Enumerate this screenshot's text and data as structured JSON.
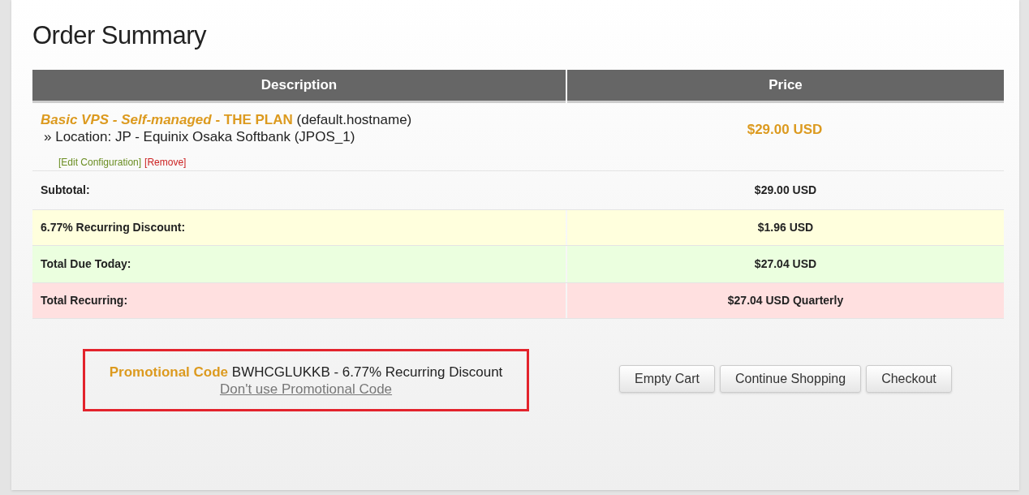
{
  "title": "Order Summary",
  "table": {
    "columns": [
      "Description",
      "Price"
    ],
    "item": {
      "product": "*Basic VPS - Self-managed* - THE PLAN",
      "hostname": "(default.hostname)",
      "location": "» Location: JP - Equinix Osaka Softbank (JPOS_1)",
      "links": [
        {
          "label": "[Edit Configuration]",
          "kind": "edit"
        },
        {
          "label": "[Remove]",
          "kind": "remove"
        }
      ],
      "price": "$29.00 USD"
    },
    "summary_rows": [
      {
        "kind": "subtotal",
        "label": "Subtotal:",
        "value": "$29.00 USD"
      },
      {
        "kind": "discount",
        "label": "6.77% Recurring Discount:",
        "value": "$1.96 USD"
      },
      {
        "kind": "due",
        "label": "Total Due Today:",
        "value": "$27.04 USD"
      },
      {
        "kind": "recurring",
        "label": "Total Recurring:",
        "value": "$27.04 USD Quarterly"
      }
    ]
  },
  "promo": {
    "label": "Promotional Code",
    "code": "BWHCGLUKKB - 6.77% Recurring Discount",
    "remove_link": "Don't use Promotional Code"
  },
  "buttons": [
    "Empty Cart",
    "Continue Shopping",
    "Checkout"
  ]
}
